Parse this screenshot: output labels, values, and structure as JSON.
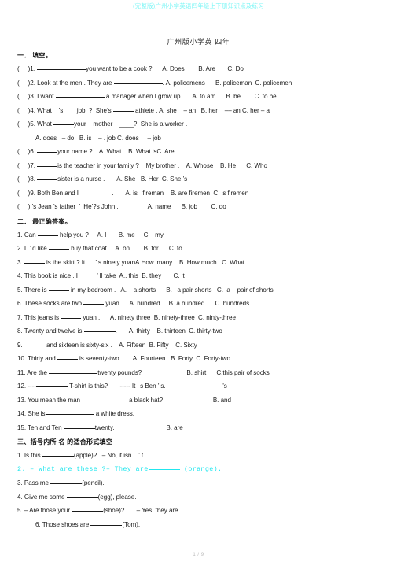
{
  "watermark": "(完整版)广州小学英语四年级上下册知识点及练习",
  "doc_title": "广州版小学英 四年",
  "colors": {
    "watermark": "#7ff6f6",
    "highlight": "#22e6ee",
    "text": "#1a1a1a"
  },
  "section1": {
    "heading": "一． 填空。",
    "items": [
      {
        "n": "(     )1.",
        "pre": "",
        "text": "you want to be a cook ?      A. Does        B. Are       C. Do",
        "blank": "long"
      },
      {
        "n": "(     )2.",
        "pre": "Look at the men . They are ",
        "text": ". A. policemens      B. policeman  C. policemen",
        "blank": "long"
      },
      {
        "n": "(     )3.",
        "pre": "I want ",
        "text": " a manager when I grow up .     A. to am      B. be        C. to be",
        "blank": "long"
      },
      {
        "n": "(     )4.",
        "pre": "What    ’s        job  ?  She’s ",
        "text": " athlete . A. she    – an   B. her    –– an C. her – a",
        "blank": "short"
      },
      {
        "n": "(     )5.",
        "pre": "What ",
        "text": "your    mother    ____?  She is a worker .",
        "blank": "short"
      },
      {
        "n": "",
        "pre": "",
        "text": "A. does   – do   B. is    – . job C. does     – job",
        "blank": "none",
        "indent": true
      },
      {
        "n": "(     )6.",
        "pre": "",
        "text": "your name ?    A. What    B. What ’sC. Are",
        "blank": "short"
      },
      {
        "n": "(     )7.",
        "pre": "",
        "text": "is the teacher in your family ?    My brother .    A. Whose    B. He      C. Who",
        "blank": "short"
      },
      {
        "n": "(     )8.",
        "pre": "",
        "text": "sister is a nurse .       A. She   B. Her  C. She ’s",
        "blank": "short"
      },
      {
        "n": "(     )9.",
        "pre": "Both Ben and I ",
        "text": ".       A. is   fireman    B. are firemen  C. is firemen",
        "blank": "medium"
      },
      {
        "n": "(     )",
        "pre": "",
        "text": "’s Jean ’s father  ’  He’?s John .                 A. name      B. job        C. do",
        "blank": "none"
      }
    ]
  },
  "section2": {
    "heading": "二． 最正确答案。",
    "items": [
      {
        "n": "1.",
        "pre": "Can ",
        "text": " help you ?     A. I       B. me     C.   my",
        "blank": "short"
      },
      {
        "n": "2.",
        "pre": "I  ’ d like ",
        "text": " buy that coat .   A. on        B. for      C. to",
        "blank": "short"
      },
      {
        "n": "3.",
        "pre": "",
        "text": " is the skirt ? It      ’ s ninety yuanA.How. many    B. How much   C. What",
        "blank": "short"
      },
      {
        "n": "4.",
        "pre": "This book is nice . I           ’ ll take  ",
        "text": "A.. this  B. they       C. it",
        "blank": "none",
        "underline": "A."
      },
      {
        "n": "5.",
        "pre": "There is ",
        "text": " in my bedroom .   A.    a shorts      B.   a pair shorts   C.  a    pair of shorts",
        "blank": "short"
      },
      {
        "n": "6.",
        "pre": "These socks are two ",
        "text": " yuan .    A. hundred     B. a hundred      C. hundreds",
        "blank": "short"
      },
      {
        "n": "7.",
        "pre": "This jeans is ",
        "text": " yuan .      A. ninety three  B. ninety-three  C. ninty-three",
        "blank": "short"
      },
      {
        "n": "8.",
        "pre": "Twenty and twelve is ",
        "text": ".       A. thirty    B. thirteen  C. thirty-two",
        "blank": "medium"
      },
      {
        "n": "9.",
        "pre": "",
        "text": " and sixteen is sixty-six .    A. Fifteen  B. Fifty    C. Sixty",
        "blank": "short"
      },
      {
        "n": "10.",
        "pre": "Thirty and ",
        "text": " is seventy-two .      A. Fourteen   B. Forty  C. Forty-two",
        "blank": "short"
      },
      {
        "n": "11.",
        "pre": "Are the ",
        "text": "twenty pounds?                          B. shirt      C.this pair of socks",
        "blank": "long"
      },
      {
        "n": "12.",
        "pre": "----",
        "text": " T-shirt is this?       ----- It ’ s Ben ’ s.                                 ’s",
        "blank": "medium"
      },
      {
        "n": "13.",
        "pre": "You mean the man",
        "text": "a black hat?                             B. and",
        "blank": "long"
      },
      {
        "n": "14.",
        "pre": "She is",
        "text": " a white dress.",
        "blank": "long"
      },
      {
        "n": "15.",
        "pre": "Ten and Ten ",
        "text": "twenty.                              B. are",
        "blank": "medium"
      }
    ]
  },
  "section3": {
    "heading": "三、括号内所 名 的适合形式填空",
    "items": [
      {
        "n": "1.",
        "pre": "Is this ",
        "text": "(apple)?   – No, it isn    ’ t.",
        "blank": "medium",
        "highlight": false
      },
      {
        "n": "2.",
        "pre": "– What are these ?– They are",
        "text": " (orange).",
        "blank": "medium",
        "highlight": true
      },
      {
        "n": "3.",
        "pre": "Pass me ",
        "text": "(pencil).",
        "blank": "medium",
        "highlight": false
      },
      {
        "n": "4.",
        "pre": "Give me some ",
        "text": "(egg), please.",
        "blank": "medium",
        "highlight": false
      },
      {
        "n": "5.",
        "pre": "– Are those your ",
        "text": "(shoe)?       – Yes, they are.",
        "blank": "medium",
        "highlight": false
      },
      {
        "n": "6.",
        "pre": "Those shoes are ",
        "text": "(Tom).",
        "blank": "medium",
        "highlight": false,
        "indent": true
      }
    ]
  },
  "footer": "1 / 9"
}
